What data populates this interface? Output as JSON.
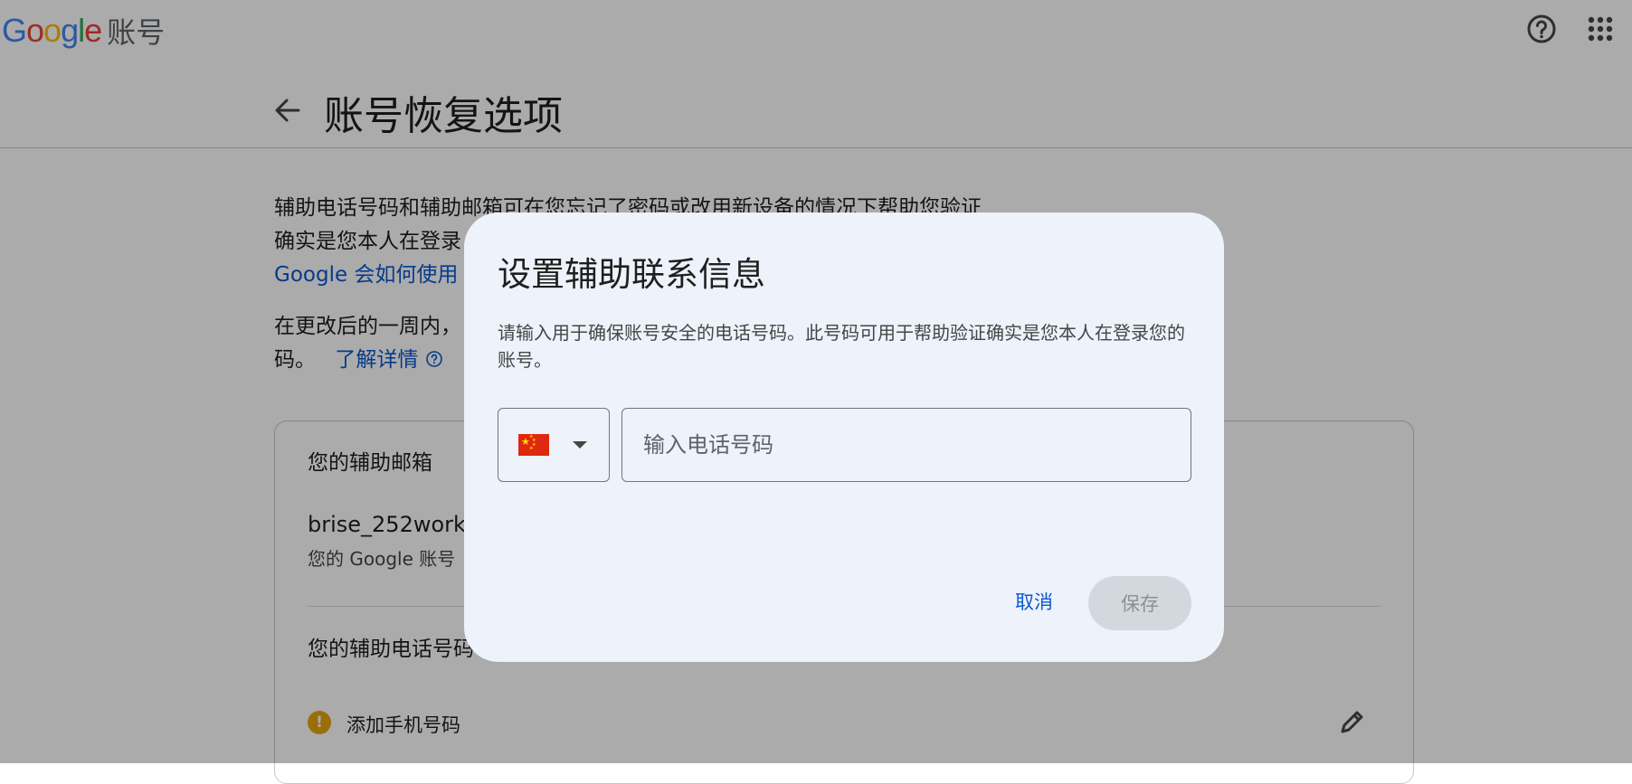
{
  "header": {
    "logo_letters": [
      "G",
      "o",
      "o",
      "g",
      "l",
      "e"
    ],
    "product": "账号",
    "help_icon": "help-circle-icon",
    "apps_icon": "apps-grid-icon"
  },
  "page": {
    "title": "账号恢复选项",
    "intro_line1": "辅助电话号码和辅助邮箱可在您忘记了密码或改用新设备的情况下帮助您验证",
    "intro_line2": "确实是您本人在登录",
    "intro_link": "Google 会如何使用",
    "change_line1": "在更改后的一周内，",
    "change_line2": "码。",
    "learn_more": "了解详情"
  },
  "card": {
    "email_label": "您的辅助邮箱",
    "email_value": "brise_252work@",
    "email_sub": "您的 Google 账号",
    "phone_label": "您的辅助电话号码",
    "add_phone": "添加手机号码"
  },
  "dialog": {
    "title": "设置辅助联系信息",
    "description": "请输入用于确保账号安全的电话号码。此号码可用于帮助验证确实是您本人在登录您的账号。",
    "country_flag": "china-flag",
    "phone_placeholder": "输入电话号码",
    "cancel": "取消",
    "save": "保存"
  },
  "colors": {
    "link": "#0b57d0",
    "dialog_bg": "#edf2fb",
    "save_disabled_bg": "#d3d7de",
    "warning": "#e8a40c"
  }
}
